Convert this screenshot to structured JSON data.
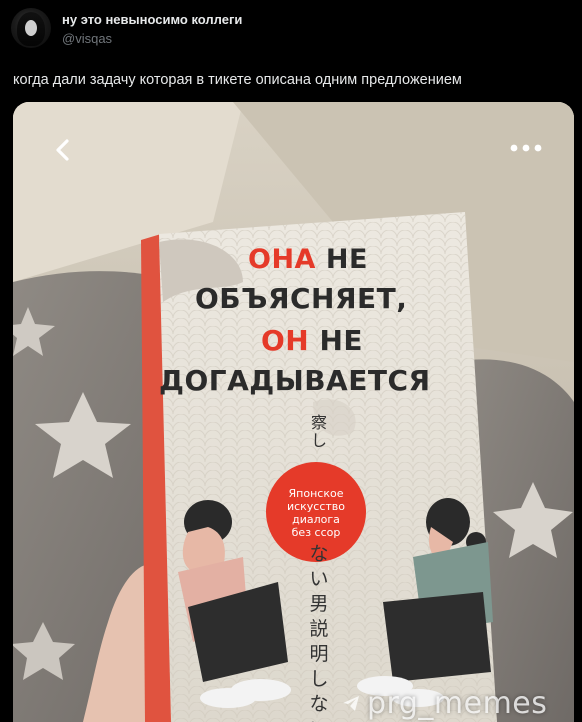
{
  "tweet": {
    "display_name": "ну это невыносимо коллеги",
    "handle": "@visqas",
    "text": "когда дали задачу которая в тикете описана одним предложением"
  },
  "media": {
    "icons": {
      "back": "chevron-left-icon",
      "more": "more-dots-icon"
    },
    "book": {
      "title_line1_red": "ОНА",
      "title_line1_rest": " НЕ",
      "title_line2": "ОБЪЯСНЯЕТ,",
      "title_line3_red": "ОН",
      "title_line3_rest": " НЕ",
      "title_line4": "ДОГАДЫВАЕТСЯ",
      "badge_line1": "Японское",
      "badge_line2": "искусство",
      "badge_line3": "диалога",
      "badge_line4": "без ссор",
      "jp_top": "察し",
      "jp_column": "ない男説明しない"
    },
    "watermark": "prg_memes",
    "colors": {
      "accent_red": "#e53a29",
      "cover": "#e9e5dc"
    }
  }
}
